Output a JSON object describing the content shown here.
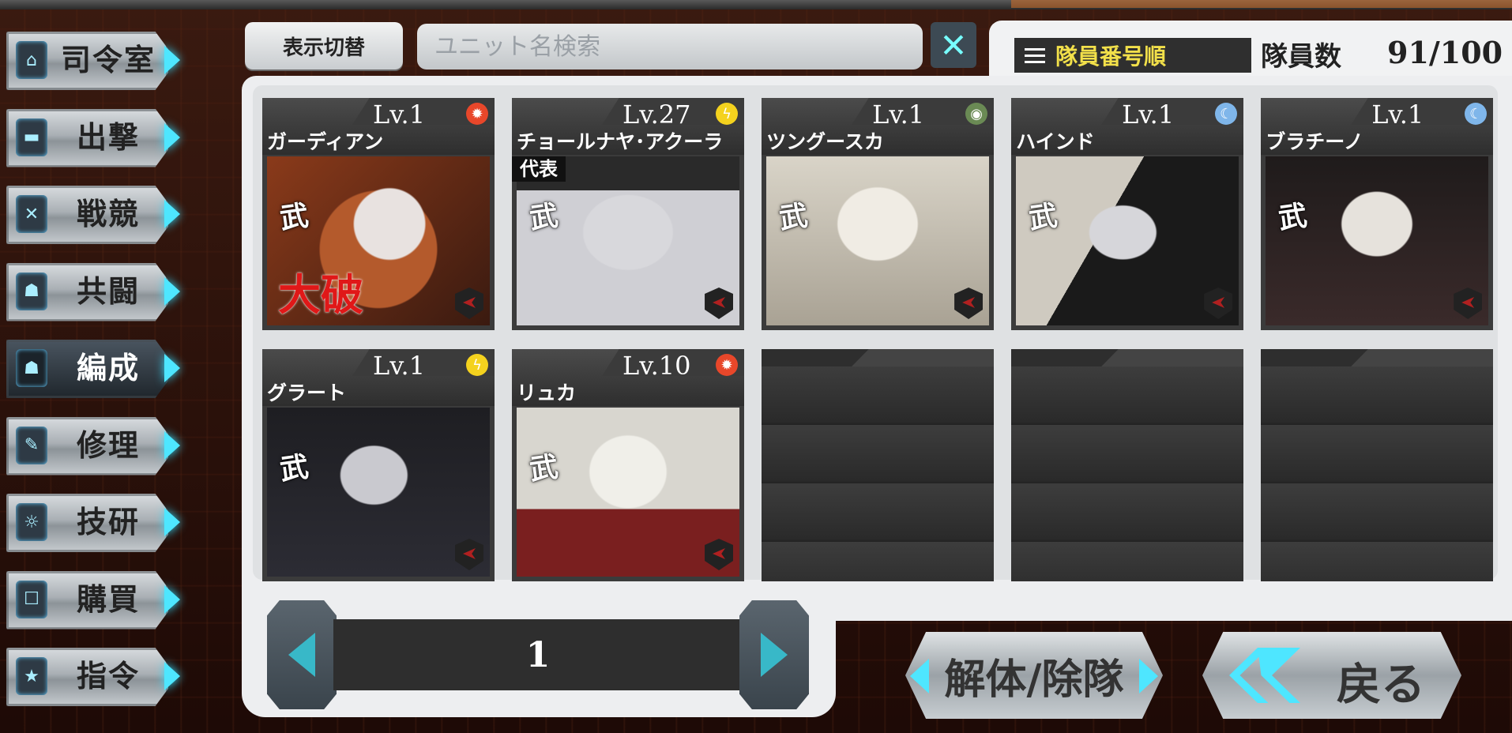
{
  "sidebar": {
    "items": [
      {
        "label": "司令室",
        "icon": "home-icon",
        "glyph": "⌂"
      },
      {
        "label": "出撃",
        "icon": "tank-icon",
        "glyph": "▬"
      },
      {
        "label": "戦競",
        "icon": "swords-icon",
        "glyph": "✕"
      },
      {
        "label": "共闘",
        "icon": "group-icon",
        "glyph": "☗"
      },
      {
        "label": "編成",
        "icon": "people-icon",
        "glyph": "☗",
        "active": true
      },
      {
        "label": "修理",
        "icon": "wrench-icon",
        "glyph": "✎"
      },
      {
        "label": "技研",
        "icon": "flame-icon",
        "glyph": "☼"
      },
      {
        "label": "購買",
        "icon": "basket-icon",
        "glyph": "☐"
      },
      {
        "label": "指令",
        "icon": "star-icon",
        "glyph": "★"
      }
    ]
  },
  "header": {
    "toggle_label": "表示切替",
    "search_placeholder": "ユニット名検索",
    "sort_label": "隊員番号順",
    "count_label": "隊員数",
    "count_value": "91/100"
  },
  "units": [
    {
      "level": "Lv.1",
      "name": "ガーディアン",
      "element": "sun",
      "element_color": "#e8472a",
      "kanji": "武",
      "status": "大破"
    },
    {
      "level": "Lv.27",
      "name": "チョールナヤ･アクーラ",
      "element": "lightning",
      "element_color": "#f4d21e",
      "kanji": "武",
      "tag": "代表"
    },
    {
      "level": "Lv.1",
      "name": "ツングースカ",
      "element": "earth",
      "element_color": "#6a8a54",
      "kanji": "武"
    },
    {
      "level": "Lv.1",
      "name": "ハインド",
      "element": "moon",
      "element_color": "#7fb6ea",
      "kanji": "武"
    },
    {
      "level": "Lv.1",
      "name": "ブラチーノ",
      "element": "moon",
      "element_color": "#7fb6ea",
      "kanji": "武"
    },
    {
      "level": "Lv.1",
      "name": "グラート",
      "element": "lightning",
      "element_color": "#f4d21e",
      "kanji": "武"
    },
    {
      "level": "Lv.10",
      "name": "リュカ",
      "element": "sun",
      "element_color": "#e8472a",
      "kanji": "武"
    }
  ],
  "pager": {
    "page": "1"
  },
  "buttons": {
    "disband": "解体/除隊",
    "back": "戻る"
  },
  "colors": {
    "accent": "#4ee6ff",
    "sort_text": "#f2e04a"
  }
}
